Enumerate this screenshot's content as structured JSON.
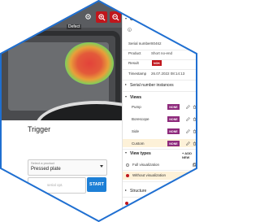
{
  "viewer": {
    "detection_label": "Defect",
    "zoom_in_icon": "zoom-in-icon",
    "zoom_out_icon": "zoom-out-icon",
    "accent": "#c0161c"
  },
  "trigger": {
    "title": "Trigger",
    "product_select": {
      "caption": "Select a product",
      "value": "Pressed plate"
    },
    "serial_input": {
      "placeholder": "serial opt."
    },
    "start_label": "START",
    "start_color": "#1d7fd6"
  },
  "panel": {
    "general_title": "General",
    "fields": [
      {
        "key": "Serial number",
        "value": "80462"
      },
      {
        "key": "Product",
        "value": "Short no-end"
      },
      {
        "key": "Result",
        "value": "NOK"
      },
      {
        "key": "Timestamp",
        "value": "26.07.2022 08:14:13"
      }
    ],
    "serial_instances_title": "Serial number instances",
    "views_title": "Views",
    "views": [
      {
        "label": "Pump",
        "badge": "NONE"
      },
      {
        "label": "Borescope",
        "badge": "NONE"
      },
      {
        "label": "Side",
        "badge": "NONE"
      },
      {
        "label": "Custom",
        "badge": "NONE"
      }
    ],
    "view_types_title": "View types",
    "add_new_label": "+ ADD NEW",
    "view_types": [
      {
        "label": "Full visualization",
        "selected": false
      },
      {
        "label": "Without visualization",
        "selected": true
      }
    ],
    "structure_title": "Structure",
    "badge_nok_color": "#c0161c",
    "badge_none_color": "#8e2a7c"
  }
}
